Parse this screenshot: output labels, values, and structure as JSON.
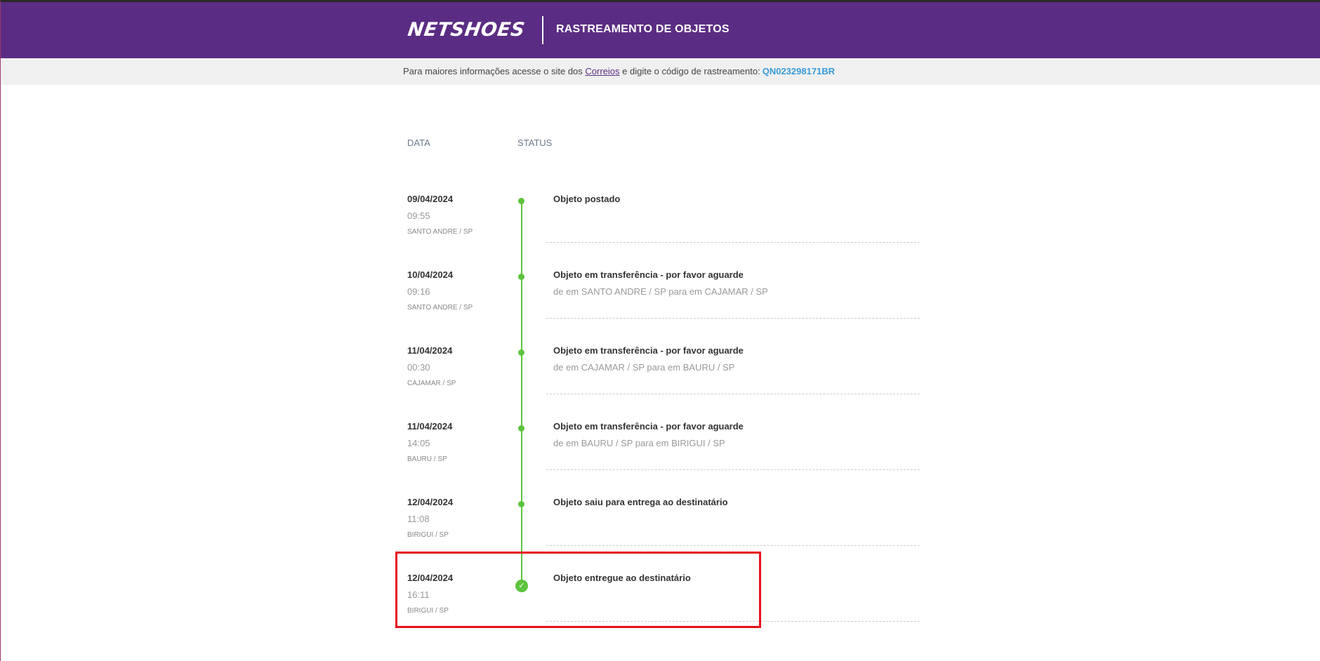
{
  "header": {
    "brand": "NETSHOES",
    "title": "RASTREAMENTO DE OBJETOS"
  },
  "infobar": {
    "text_before": "Para maiores informações acesse o site dos ",
    "link_label": "Correios",
    "text_after": " e digite o código de rastreamento:",
    "tracking_code": "QN023298171BR"
  },
  "columns": {
    "data": "DATA",
    "status": "STATUS"
  },
  "events": [
    {
      "date": "09/04/2024",
      "time": "09:55",
      "place": "SANTO ANDRE / SP",
      "status": "Objeto postado",
      "detail": ""
    },
    {
      "date": "10/04/2024",
      "time": "09:16",
      "place": "SANTO ANDRE / SP",
      "status": "Objeto em transferência - por favor aguarde",
      "detail": "de em SANTO ANDRE / SP para em CAJAMAR / SP"
    },
    {
      "date": "11/04/2024",
      "time": "00:30",
      "place": "CAJAMAR / SP",
      "status": "Objeto em transferência - por favor aguarde",
      "detail": "de em CAJAMAR / SP para em BAURU / SP"
    },
    {
      "date": "11/04/2024",
      "time": "14:05",
      "place": "BAURU / SP",
      "status": "Objeto em transferência - por favor aguarde",
      "detail": "de em BAURU / SP para em BIRIGUI / SP"
    },
    {
      "date": "12/04/2024",
      "time": "11:08",
      "place": "BIRIGUI / SP",
      "status": "Objeto saiu para entrega ao destinatário",
      "detail": ""
    },
    {
      "date": "12/04/2024",
      "time": "16:11",
      "place": "BIRIGUI / SP",
      "status": "Objeto entregue ao destinatário",
      "detail": ""
    }
  ],
  "icons": {
    "timeline_dot": "circle-dot-icon",
    "delivered": "check-circle-icon"
  },
  "colors": {
    "header_bg": "#5b2c83",
    "timeline": "#5cc43d",
    "tracking_code": "#3a9bd9",
    "highlight": "#e8101a"
  }
}
